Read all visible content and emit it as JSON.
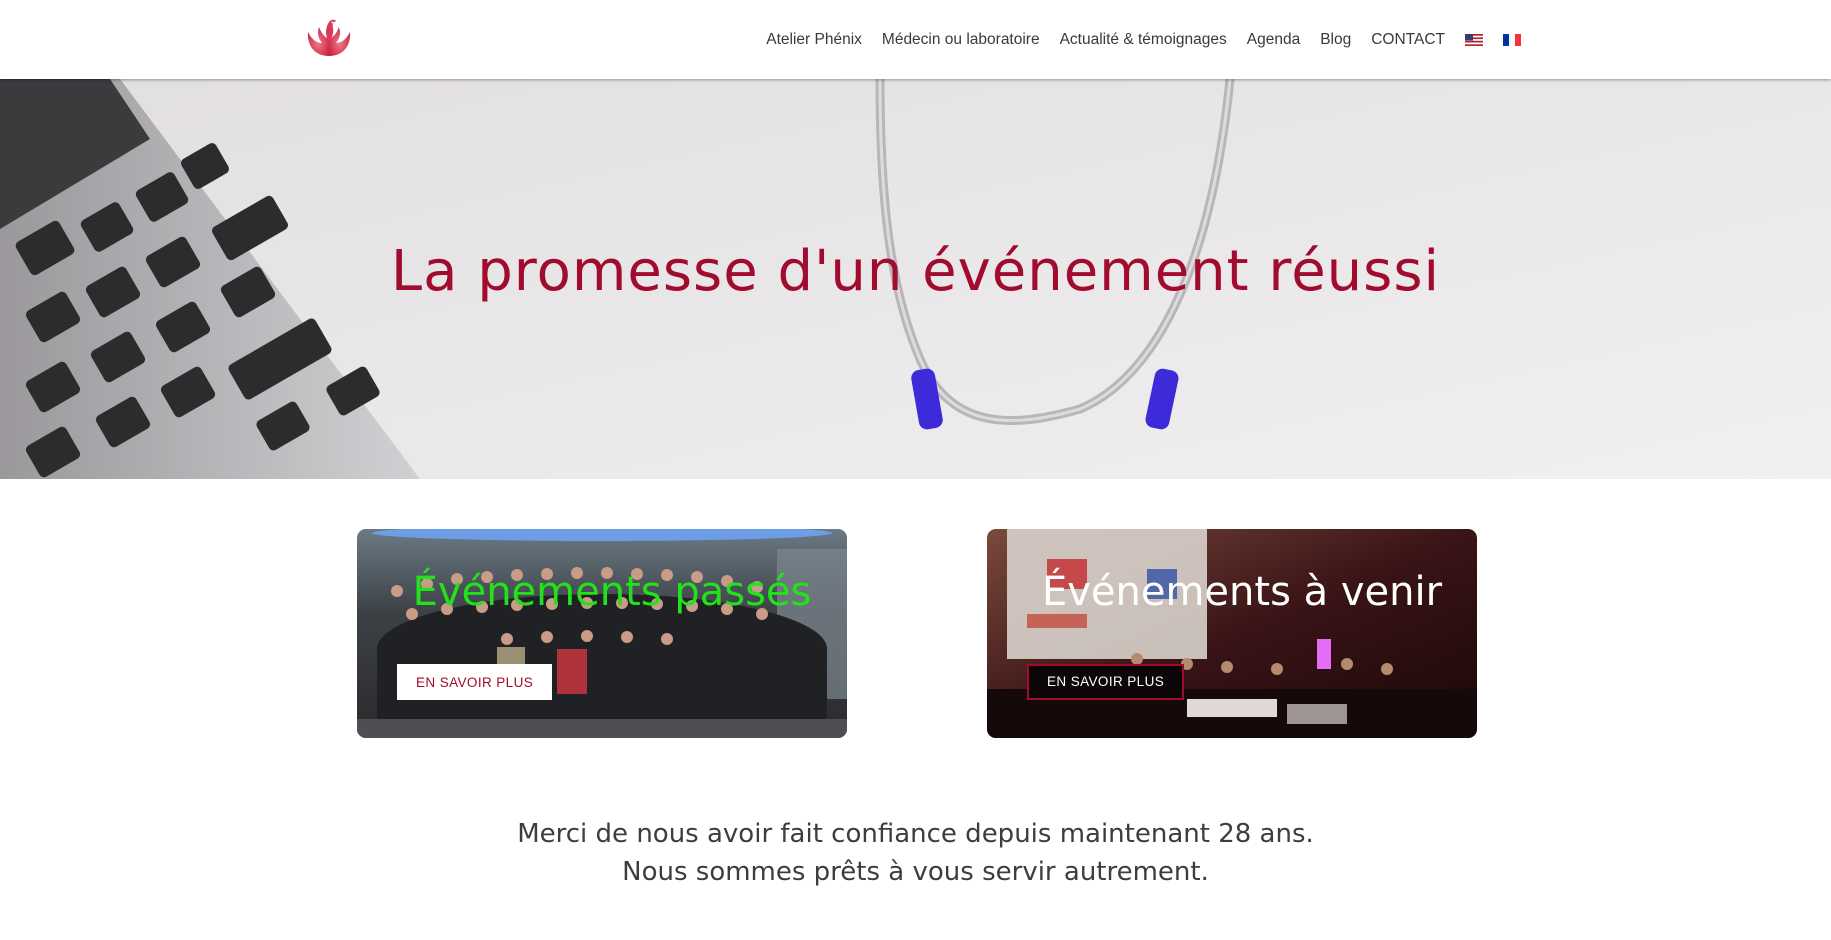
{
  "header": {
    "logo_icon": "phoenix-logo-icon",
    "brand_color": "#d83a5a",
    "nav": [
      {
        "label": "Atelier Phénix"
      },
      {
        "label": "Médecin ou laboratoire"
      },
      {
        "label": "Actualité & témoignages"
      },
      {
        "label": "Agenda"
      },
      {
        "label": "Blog"
      },
      {
        "label": "CONTACT"
      }
    ],
    "flags": [
      "us-flag-icon",
      "fr-flag-icon"
    ]
  },
  "hero": {
    "title": "La promesse d'un événement réussi",
    "title_color": "#a10b2e",
    "background": "laptop-and-stethoscope-photo"
  },
  "cards": [
    {
      "title": "Événements passés",
      "title_color": "#22e31a",
      "button": "EN SAVOIR PLUS",
      "photo": "group-photo"
    },
    {
      "title": "Événements à venir",
      "title_color": "#ffffff",
      "button": "EN SAVOIR PLUS",
      "photo": "conference-stage-photo"
    }
  ],
  "thanks": {
    "line1": "Merci de nous avoir fait confiance depuis maintenant 28 ans.",
    "line2": "Nous sommes prêts à vous servir autrement."
  }
}
